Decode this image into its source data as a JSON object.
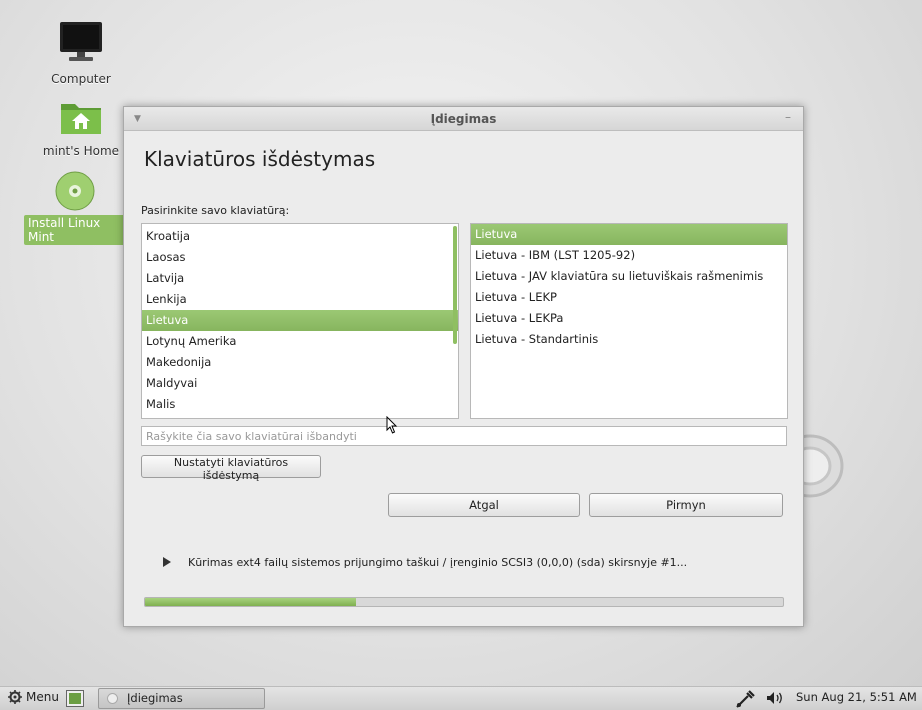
{
  "desktop": {
    "icons": [
      {
        "label": "Computer",
        "icon": "monitor-icon"
      },
      {
        "label": "mint's Home",
        "icon": "home-folder-icon"
      },
      {
        "label": "Install Linux Mint",
        "icon": "disc-icon"
      }
    ]
  },
  "window": {
    "title": "Įdiegimas",
    "heading": "Klaviatūros išdėstymas",
    "prompt": "Pasirinkite savo klaviatūrą:",
    "layouts": [
      "Kroatija",
      "Laosas",
      "Latvija",
      "Lenkija",
      "Lietuva",
      "Lotynų Amerika",
      "Makedonija",
      "Maldyvai",
      "Malis"
    ],
    "selected_layout": "Lietuva",
    "variants": [
      "Lietuva",
      "Lietuva - IBM (LST 1205-92)",
      "Lietuva - JAV klaviatūra su lietuviškais rašmenimis",
      "Lietuva - LEKP",
      "Lietuva - LEKPa",
      "Lietuva - Standartinis"
    ],
    "selected_variant": "Lietuva",
    "test_placeholder": "Rašykite čia savo klaviatūrai išbandyti",
    "detect_button": "Nustatyti klaviatūros išdėstymą",
    "back_button": "Atgal",
    "forward_button": "Pirmyn",
    "progress_text": "Kūrimas ext4 failų sistemos prijungimo taškui / įrenginio SCSI3 (0,0,0) (sda) skirsnyje #1...",
    "progress_fraction": 0.33
  },
  "panel": {
    "menu_label": "Menu",
    "task_label": "Įdiegimas",
    "clock": "Sun Aug 21,  5:51 AM"
  },
  "colors": {
    "accent": "#8fbf62",
    "window_bg": "#ececec"
  }
}
